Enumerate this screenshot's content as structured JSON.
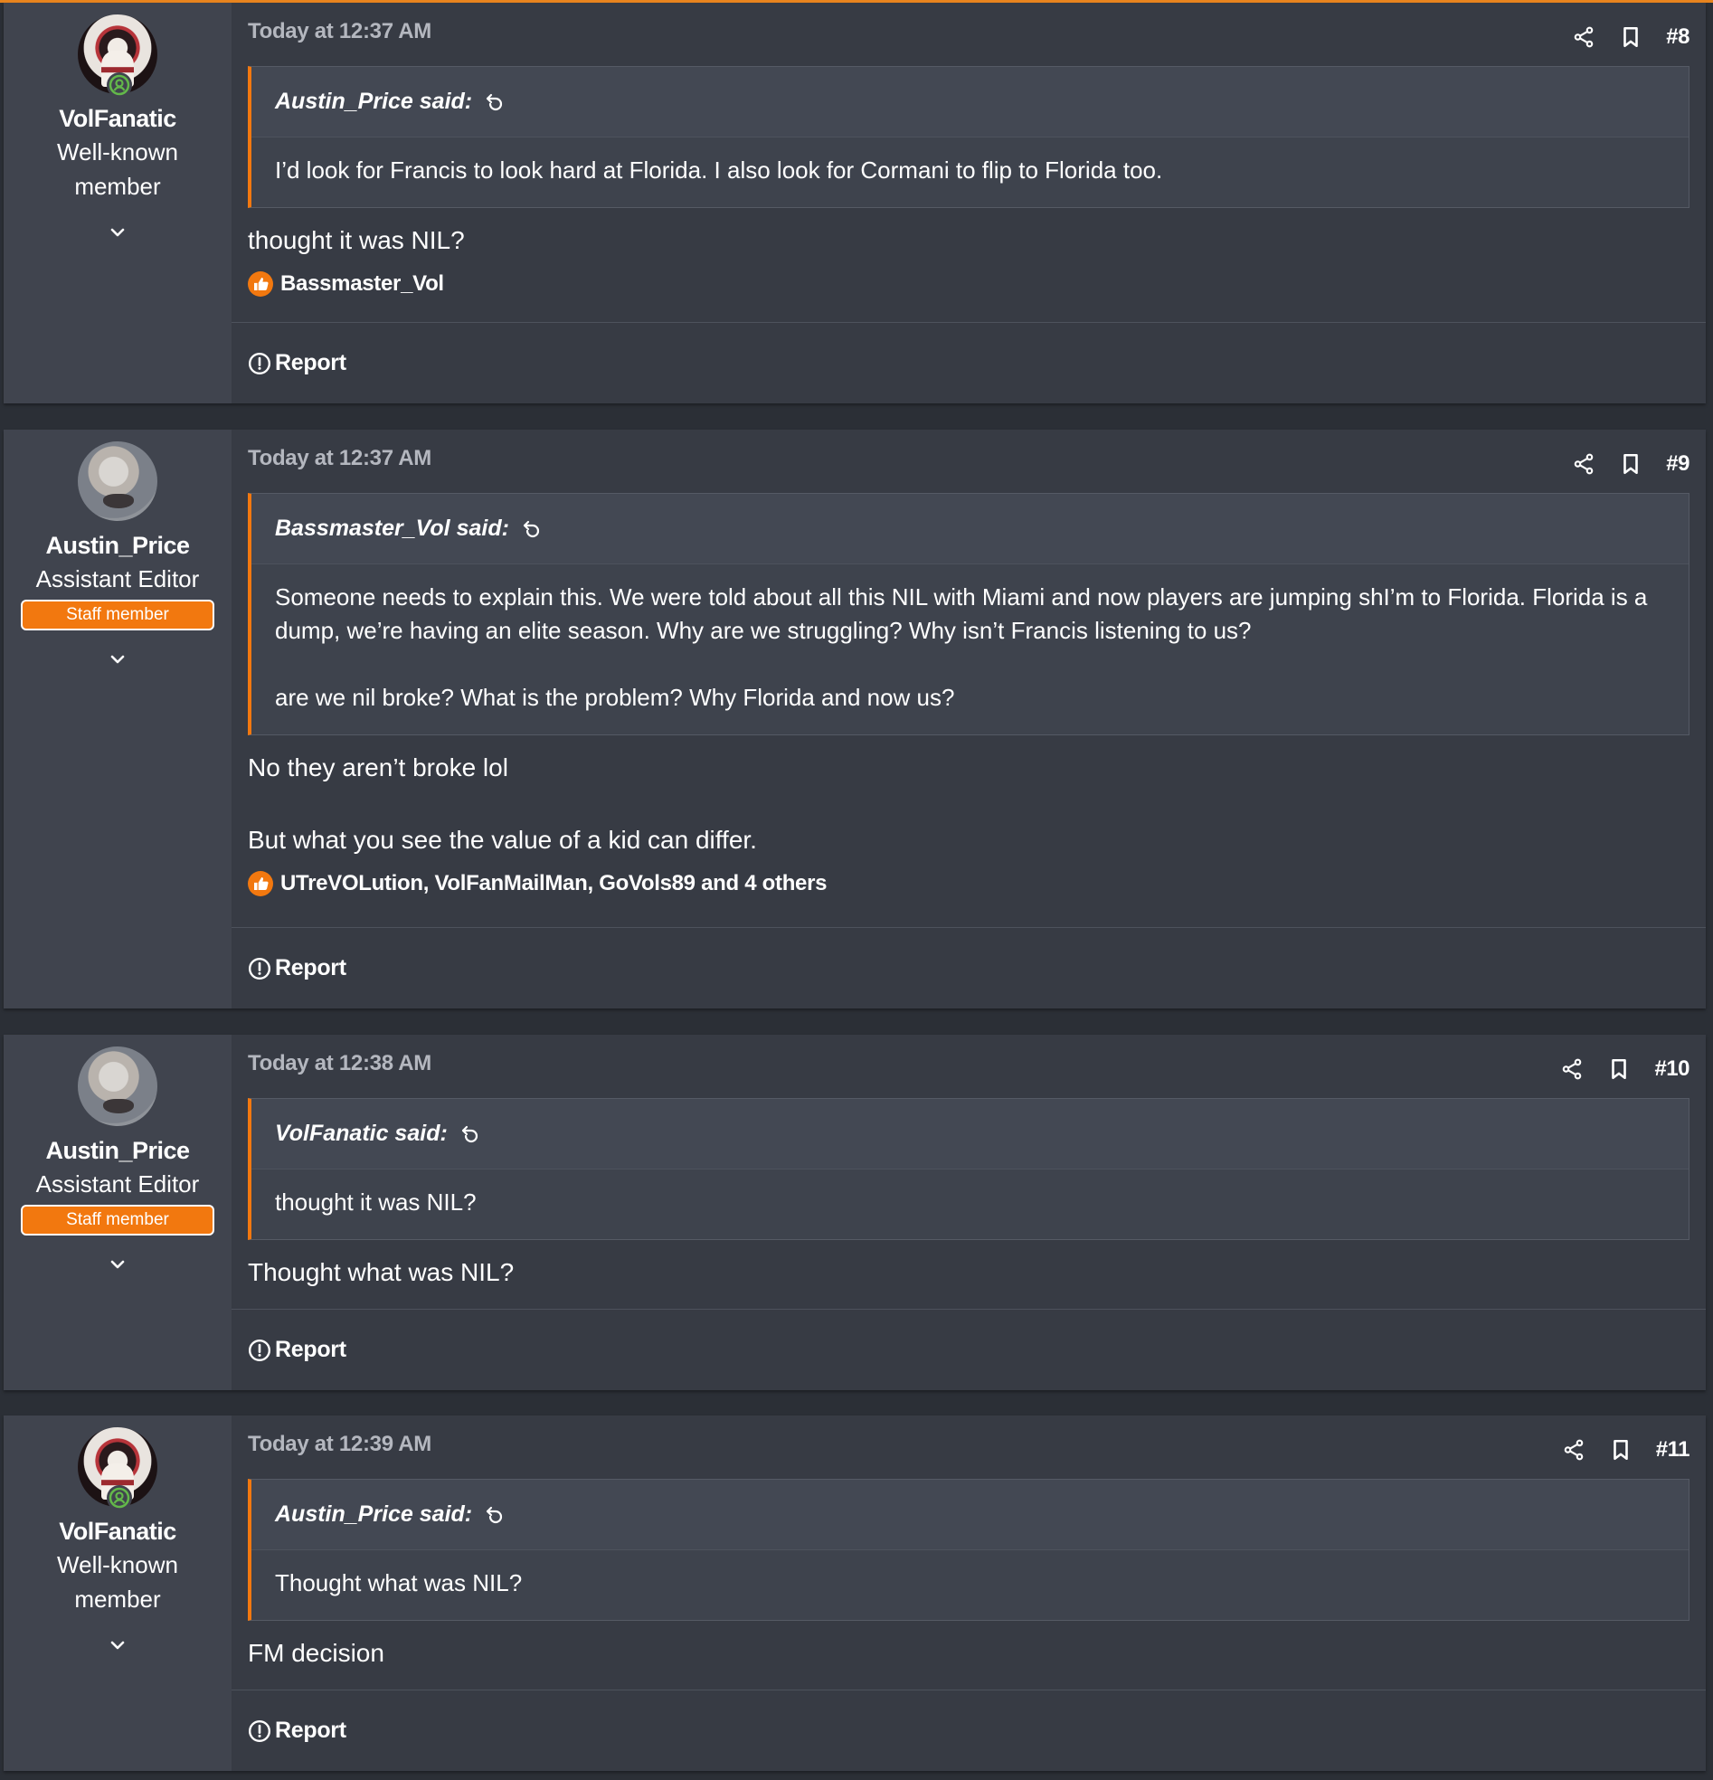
{
  "accent_color": "#f2780f",
  "posts": [
    {
      "author": {
        "name": "VolFanatic",
        "title": "Well-known member",
        "avatar": "anime-avatar",
        "online": true
      },
      "timestamp": "Today at 12:37 AM",
      "number": "#8",
      "quote": {
        "author_label": "Austin_Price said:",
        "text": [
          "I’d look for Francis to look hard at Florida. I also look for Cormani to flip to Florida too."
        ]
      },
      "message": [
        "thought it was NIL?"
      ],
      "reactions": "Bassmaster_Vol",
      "report_label": "Report"
    },
    {
      "author": {
        "name": "Austin_Price",
        "title": "Assistant Editor",
        "badge": "Staff member",
        "avatar": "bald-avatar"
      },
      "timestamp": "Today at 12:37 AM",
      "number": "#9",
      "quote": {
        "author_label": "Bassmaster_Vol said:",
        "text": [
          "Someone needs to explain this. We were told about all this NIL with Miami and now players are jumping shI’m to Florida. Florida is a dump, we’re having an elite season. Why are we struggling? Why isn’t Francis listening to us?",
          "are we nil broke? What is the problem? Why Florida and now us?"
        ]
      },
      "message": [
        "No they aren’t broke lol",
        "But what you see the value of a kid can differ."
      ],
      "reactions": "UTreVOLution, VolFanMailMan, GoVols89 and 4 others",
      "report_label": "Report"
    },
    {
      "author": {
        "name": "Austin_Price",
        "title": "Assistant Editor",
        "badge": "Staff member",
        "avatar": "bald-avatar"
      },
      "timestamp": "Today at 12:38 AM",
      "number": "#10",
      "quote": {
        "author_label": "VolFanatic said:",
        "text": [
          "thought it was NIL?"
        ]
      },
      "message": [
        "Thought what was NIL?"
      ],
      "report_label": "Report"
    },
    {
      "author": {
        "name": "VolFanatic",
        "title": "Well-known member",
        "avatar": "anime-avatar",
        "online": true
      },
      "timestamp": "Today at 12:39 AM",
      "number": "#11",
      "quote": {
        "author_label": "Austin_Price said:",
        "text": [
          "Thought what was NIL?"
        ]
      },
      "message": [
        "FM decision"
      ],
      "report_label": "Report"
    }
  ]
}
